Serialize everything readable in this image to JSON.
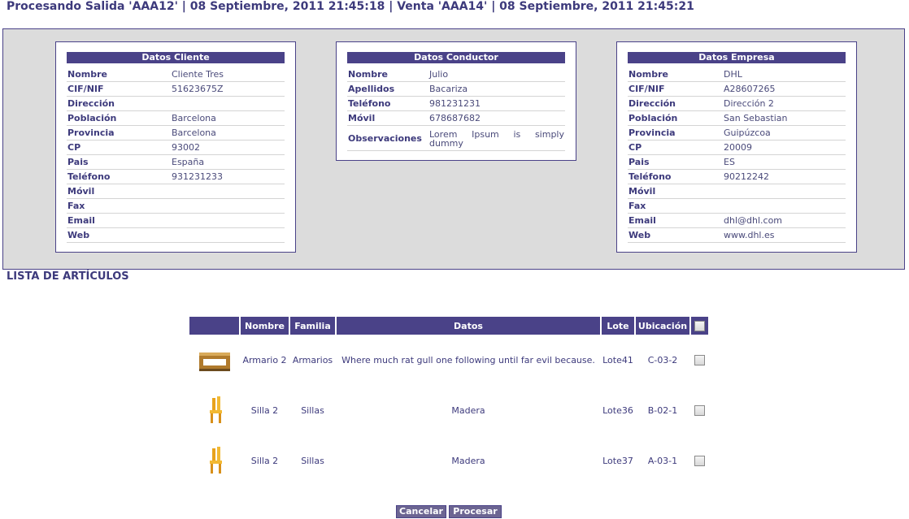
{
  "header": {
    "title": "Procesando Salida 'AAA12' | 08 Septiembre, 2011 21:45:18 | Venta 'AAA14' | 08 Septiembre, 2011 21:45:21"
  },
  "cliente": {
    "title": "Datos Cliente",
    "rows": [
      {
        "label": "Nombre",
        "value": "Cliente Tres"
      },
      {
        "label": "CIF/NIF",
        "value": "51623675Z"
      },
      {
        "label": "Dirección",
        "value": ""
      },
      {
        "label": "Población",
        "value": "Barcelona"
      },
      {
        "label": "Provincia",
        "value": "Barcelona"
      },
      {
        "label": "CP",
        "value": "93002"
      },
      {
        "label": "Pais",
        "value": "España"
      },
      {
        "label": "Teléfono",
        "value": "931231233"
      },
      {
        "label": "Móvil",
        "value": ""
      },
      {
        "label": "Fax",
        "value": ""
      },
      {
        "label": "Email",
        "value": ""
      },
      {
        "label": "Web",
        "value": ""
      }
    ]
  },
  "conductor": {
    "title": "Datos Conductor",
    "rows": [
      {
        "label": "Nombre",
        "value": "Julio"
      },
      {
        "label": "Apellidos",
        "value": "Bacariza"
      },
      {
        "label": "Teléfono",
        "value": "981231231"
      },
      {
        "label": "Móvil",
        "value": "678687682"
      },
      {
        "label": "Observaciones",
        "value": "Lorem Ipsum is simply dummy"
      }
    ]
  },
  "empresa": {
    "title": "Datos Empresa",
    "rows": [
      {
        "label": "Nombre",
        "value": "DHL"
      },
      {
        "label": "CIF/NIF",
        "value": "A28607265"
      },
      {
        "label": "Dirección",
        "value": "Dirección 2"
      },
      {
        "label": "Población",
        "value": "San Sebastian"
      },
      {
        "label": "Provincia",
        "value": "Guipúzcoa"
      },
      {
        "label": "CP",
        "value": "20009"
      },
      {
        "label": "Pais",
        "value": "ES"
      },
      {
        "label": "Teléfono",
        "value": "90212242"
      },
      {
        "label": "Móvil",
        "value": ""
      },
      {
        "label": "Fax",
        "value": ""
      },
      {
        "label": "Email",
        "value": "dhl@dhl.com"
      },
      {
        "label": "Web",
        "value": "www.dhl.es"
      }
    ]
  },
  "articulos": {
    "title": "LISTA DE ARTÍCULOS",
    "columns": [
      "",
      "Nombre",
      "Familia",
      "Datos",
      "Lote",
      "Ubicación"
    ],
    "rows": [
      {
        "icon": "cabinet-thumbnail",
        "nombre": "Armario 2",
        "familia": "Armarios",
        "datos": "Where much rat gull one following until far evil because.",
        "lote": "Lote41",
        "ubicacion": "C-03-2"
      },
      {
        "icon": "chair-thumbnail",
        "nombre": "Silla 2",
        "familia": "Sillas",
        "datos": "Madera",
        "lote": "Lote36",
        "ubicacion": "B-02-1"
      },
      {
        "icon": "chair-thumbnail",
        "nombre": "Silla 2",
        "familia": "Sillas",
        "datos": "Madera",
        "lote": "Lote37",
        "ubicacion": "A-03-1"
      }
    ]
  },
  "buttons": {
    "cancel": "Cancelar",
    "process": "Procesar"
  }
}
